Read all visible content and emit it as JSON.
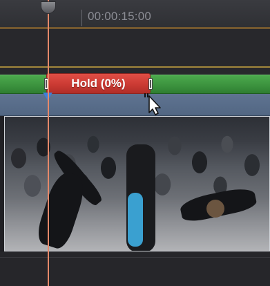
{
  "ruler": {
    "timecode": "00:00:15:00"
  },
  "retime": {
    "segment_label": "Hold (0%)",
    "colors": {
      "normal_speed": "#3c933e",
      "hold": "#cb3a33"
    }
  },
  "clip": {
    "header_color": "#5f7391",
    "marker_color": "#3c7fd9"
  },
  "playhead": {
    "color": "#e6896a"
  },
  "icons": {
    "pointer": "arrow-cursor-with-resize-icon",
    "handle": "retime-handle-icon",
    "marker": "marker-icon"
  }
}
